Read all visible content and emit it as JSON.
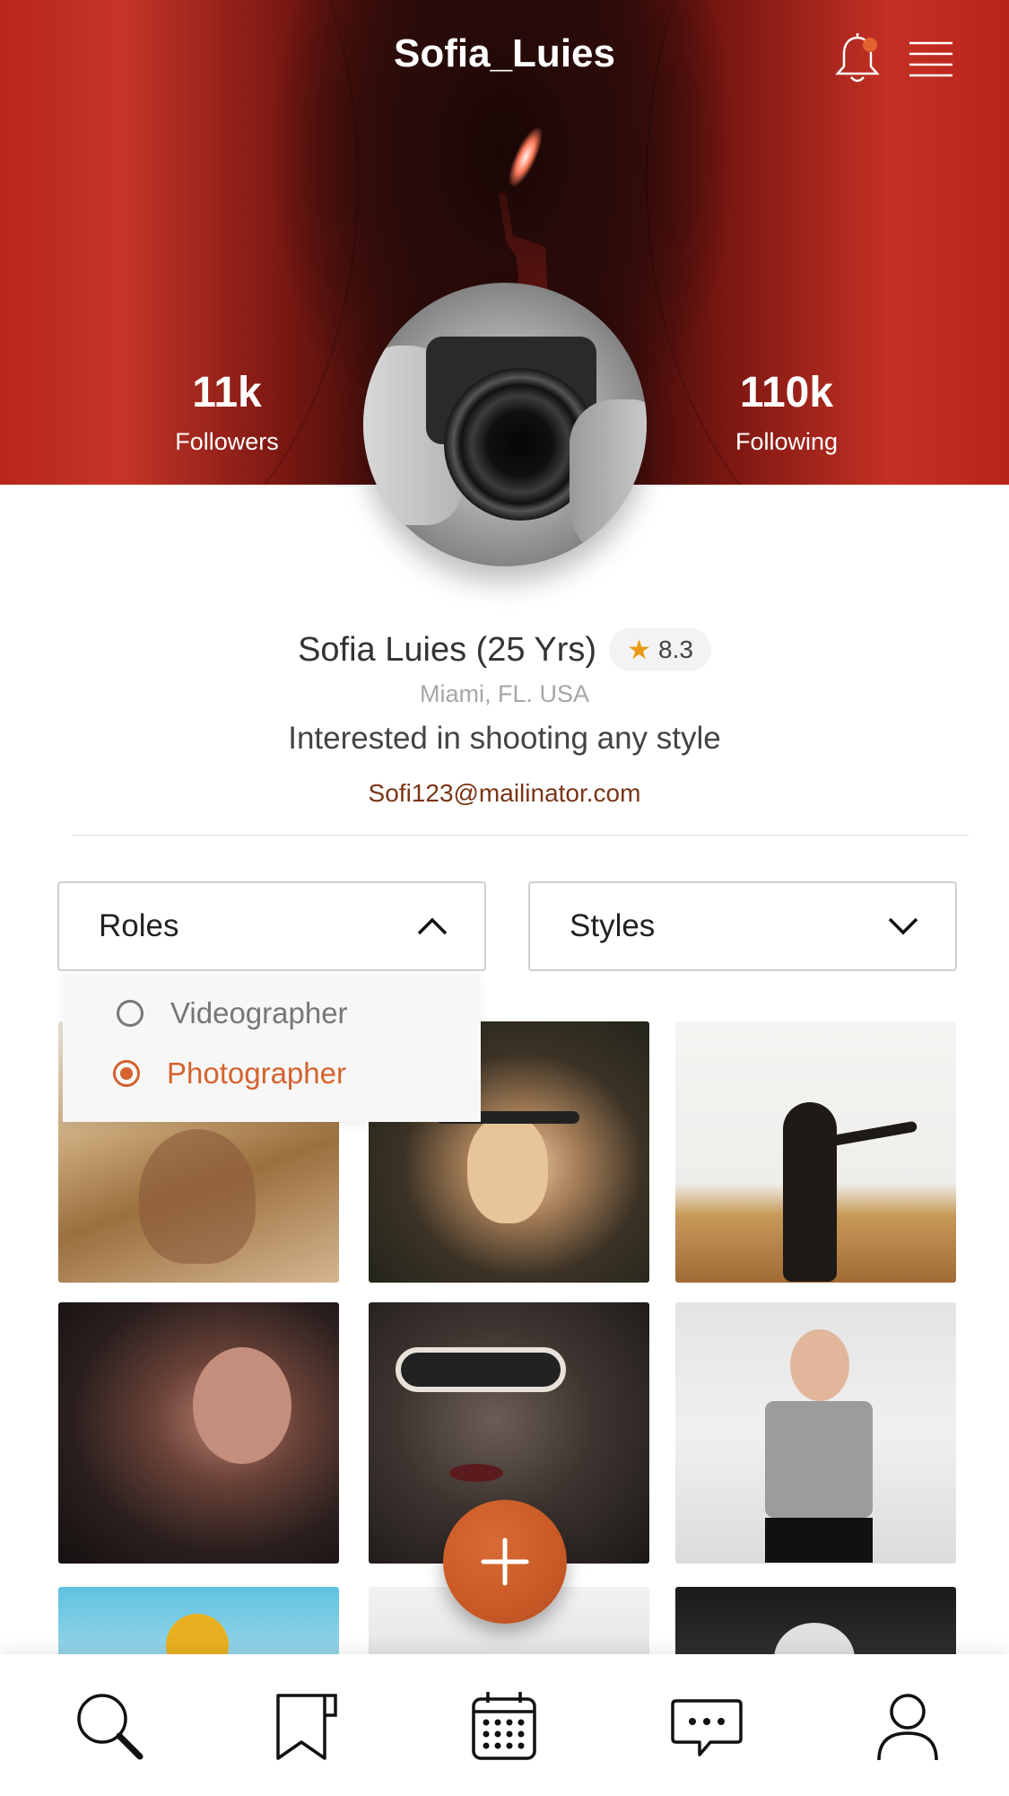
{
  "header": {
    "username": "Sofia_Luies",
    "icons": [
      "bell-icon",
      "menu-icon"
    ],
    "notification_dot_color": "#e0622d"
  },
  "stats": {
    "followers": {
      "value": "11k",
      "label": "Followers"
    },
    "following": {
      "value": "110k",
      "label": "Following"
    }
  },
  "profile": {
    "name": "Sofia Luies (25 Yrs)",
    "rating": "8.3",
    "location": "Miami, FL. USA",
    "bio": "Interested in shooting any style",
    "email": "Sofi123@mailinator.com"
  },
  "filters": {
    "roles": {
      "label": "Roles",
      "expanded": true,
      "options": [
        {
          "label": "Videographer",
          "selected": false
        },
        {
          "label": "Photographer",
          "selected": true
        }
      ]
    },
    "styles": {
      "label": "Styles",
      "expanded": false
    }
  },
  "gallery": {
    "items": [
      "photo",
      "photo",
      "photo",
      "photo",
      "photo",
      "photo",
      "photo",
      "photo",
      "photo"
    ]
  },
  "fab": {
    "icon": "plus-icon"
  },
  "bottom_nav": {
    "items": [
      "search-icon",
      "bookmark-icon",
      "calendar-icon",
      "chat-icon",
      "profile-icon"
    ]
  },
  "colors": {
    "accent": "#d4632e",
    "email": "#7a3515",
    "star": "#e89a14"
  }
}
